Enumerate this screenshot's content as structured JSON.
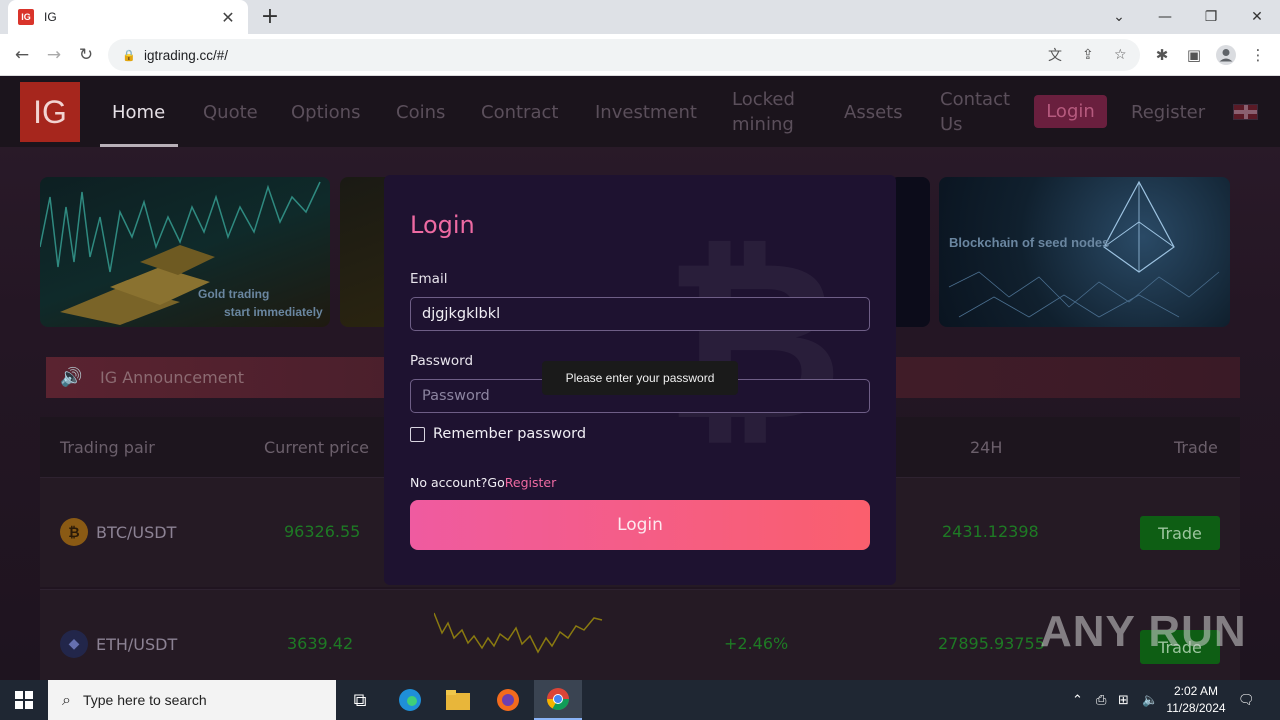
{
  "browser": {
    "tab_title": "IG",
    "favicon_text": "IG",
    "url": "igtrading.cc/#/"
  },
  "nav": {
    "logo": "IG",
    "items": [
      {
        "label": "Home"
      },
      {
        "label": "Quote"
      },
      {
        "label": "Options"
      },
      {
        "label": "Coins"
      },
      {
        "label": "Contract"
      },
      {
        "label": "Investment"
      },
      {
        "label": "Locked mining"
      },
      {
        "label": "Assets"
      },
      {
        "label": "Contact Us"
      }
    ],
    "login": "Login",
    "register": "Register"
  },
  "banners": {
    "b1_line1": "Gold trading",
    "b1_line2": "start immediately",
    "b4_text": "Blockchain of seed nodes"
  },
  "announcement": {
    "text": "IG Announcement"
  },
  "table": {
    "headers": {
      "pair": "Trading pair",
      "price": "Current price",
      "h24": "24H",
      "trade": "Trade"
    },
    "rows": [
      {
        "symbol": "BTC/USDT",
        "price": "96326.55",
        "change": "",
        "volume": "2431.12398",
        "trade": "Trade"
      },
      {
        "symbol": "ETH/USDT",
        "price": "3639.42",
        "change": "+2.46%",
        "volume": "27895.93755",
        "trade": "Trade"
      }
    ]
  },
  "login_modal": {
    "title": "Login",
    "email_label": "Email",
    "email_value": "djgjkgklbkl",
    "password_label": "Password",
    "password_placeholder": "Password",
    "tooltip": "Please enter your password",
    "remember": "Remember password",
    "no_account": "No account?Go",
    "register_link": "Register",
    "submit": "Login"
  },
  "taskbar": {
    "search_placeholder": "Type here to search",
    "time": "2:02 AM",
    "date": "11/28/2024"
  },
  "watermark": "ANY RUN",
  "colors": {
    "accent_pink": "#ee6aa2",
    "price_green": "#1e7a24",
    "trade_green": "#0e5e14"
  }
}
